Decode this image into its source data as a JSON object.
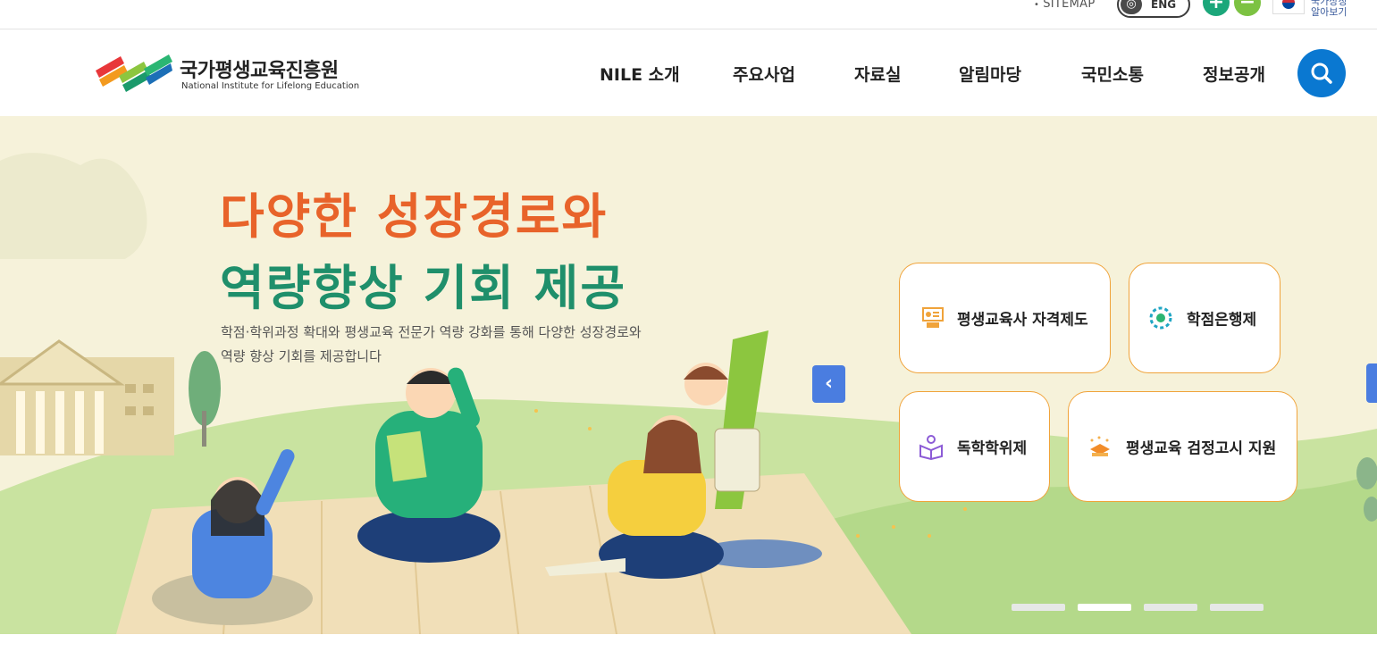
{
  "topbar": {
    "sitemap_label": "SITEMAP",
    "lang_toggle_label": "ENG",
    "zoom_in_label": "+",
    "zoom_out_label": "−",
    "flag_text_line1": "국가상징",
    "flag_text_line2": "알아보기"
  },
  "header": {
    "logo_kr": "국가평생교육진흥원",
    "logo_en": "National Institute for Lifelong Education",
    "nav": [
      "NILE 소개",
      "주요사업",
      "자료실",
      "알림마당",
      "국민소통",
      "정보공개"
    ]
  },
  "hero": {
    "headline_line1": "다양한 성장경로와",
    "headline_line2": "역량향상 기회 제공",
    "description_line1": "학점·학위과정 확대와 평생교육 전문가 역량 강화를 통해 다양한 성장경로와",
    "description_line2": "역량 향상 기회를 제공합니다",
    "services": [
      {
        "label": "평생교육사 자격제도",
        "icon": "certificate-icon"
      },
      {
        "label": "학점은행제",
        "icon": "credit-bank-icon"
      },
      {
        "label": "독학학위제",
        "icon": "self-study-icon"
      },
      {
        "label": "평생교육 검정고시 지원",
        "icon": "exam-support-icon"
      }
    ],
    "prev_label": "‹",
    "slides_total": 4,
    "active_slide": 2
  },
  "colors": {
    "accent_orange": "#e8632a",
    "accent_green": "#1f8f6b",
    "search_blue": "#0a78d1",
    "hero_bg": "#f6f2da",
    "card_border": "#f0a33a"
  }
}
